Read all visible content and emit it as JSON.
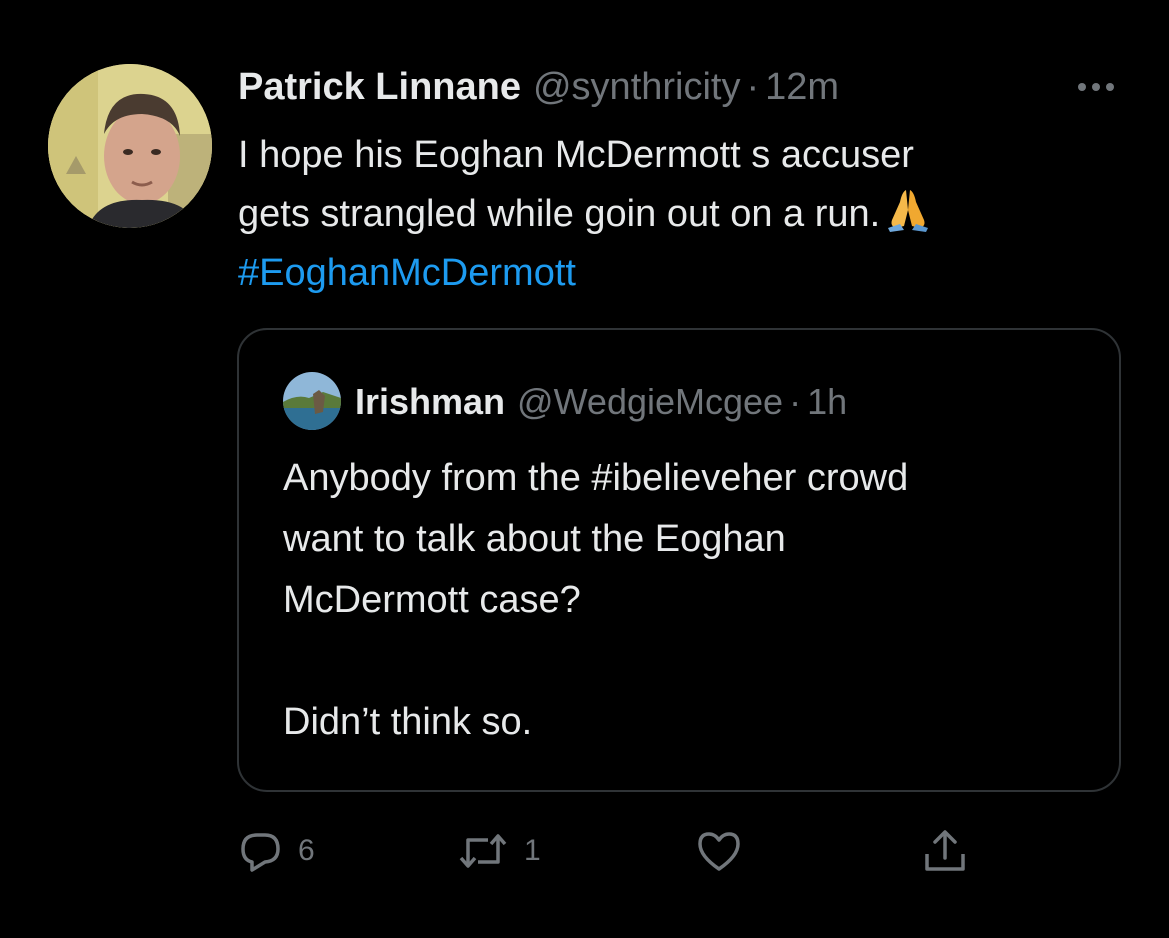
{
  "tweet": {
    "display_name": "Patrick Linnane",
    "handle": "@synthricity",
    "separator": "·",
    "time": "12m",
    "more_icon": "more-horizontal-icon",
    "text_lines": [
      "I hope his Eoghan McDermott s accuser",
      "gets strangled while goin out on a run."
    ],
    "emoji": "🙏",
    "hashtag": "#EoghanMcDermott"
  },
  "quoted_tweet": {
    "display_name": "Irishman",
    "handle": "@WedgieMcgee",
    "separator": "·",
    "time": "1h",
    "text_lines": [
      "Anybody from the #ibelieveher crowd",
      "want to talk about the Eoghan",
      "McDermott case?",
      "",
      "Didn’t think so."
    ]
  },
  "actions": {
    "reply": {
      "icon": "reply-icon",
      "count": "6"
    },
    "retweet": {
      "icon": "retweet-icon",
      "count": "1"
    },
    "like": {
      "icon": "heart-icon",
      "count": ""
    },
    "share": {
      "icon": "share-icon",
      "count": ""
    }
  },
  "colors": {
    "background": "#000000",
    "text": "#e7e9ea",
    "secondary": "#71767b",
    "accent": "#1d9bf0",
    "border": "#2f3336"
  }
}
